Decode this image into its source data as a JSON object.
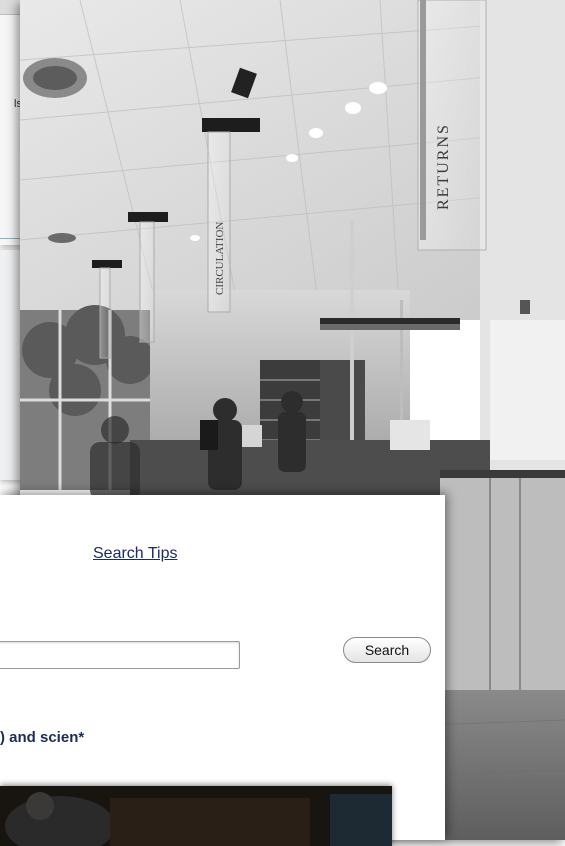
{
  "back_window": {
    "snippet_text": "ls in"
  },
  "photo": {
    "signs": {
      "returns": "RETURNS",
      "circulation": "CIRCULATION"
    }
  },
  "search_panel": {
    "search_tips_link": "Search Tips",
    "search_input": {
      "value": "",
      "placeholder": ""
    },
    "search_button_label": "Search",
    "query_echo": ") and scien*"
  }
}
